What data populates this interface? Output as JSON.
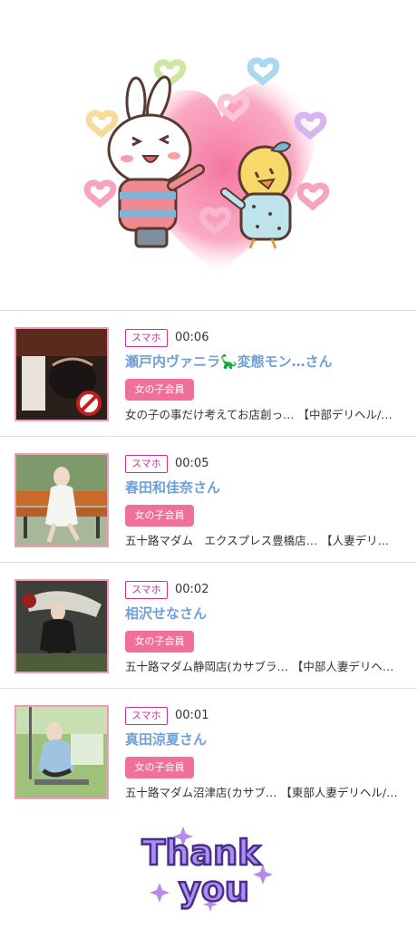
{
  "users": [
    {
      "device": "スマホ",
      "time": "00:06",
      "name": "瀬戸内ヴァニラ🦕変態モン…さん",
      "member_label": "女の子会員",
      "shop": "女の子の事だけ考えてお店創っ… 【中部デリヘル/…"
    },
    {
      "device": "スマホ",
      "time": "00:05",
      "name": "春田和佳奈さん",
      "member_label": "女の子会員",
      "shop": "五十路マダム　エクスプレス豊橋店… 【人妻デリ…"
    },
    {
      "device": "スマホ",
      "time": "00:02",
      "name": "相沢せなさん",
      "member_label": "女の子会員",
      "shop": "五十路マダム静岡店(カサブラ… 【中部人妻デリヘ…"
    },
    {
      "device": "スマホ",
      "time": "00:01",
      "name": "真田涼夏さん",
      "member_label": "女の子会員",
      "shop": "五十路マダム沼津店(カサブ… 【東部人妻デリヘル/…"
    }
  ],
  "footer": {
    "thank_you_line1": "Thank",
    "thank_you_line2": "you"
  },
  "colors": {
    "accent_pink": "#f0709a",
    "badge_magenta": "#cc3399",
    "name_blue": "#6e9fd9",
    "thumb_border": "#f39ab4"
  },
  "icons": {
    "banner": "bunny-and-chick-heart-sticker",
    "footer": "thank-you-sticker"
  }
}
